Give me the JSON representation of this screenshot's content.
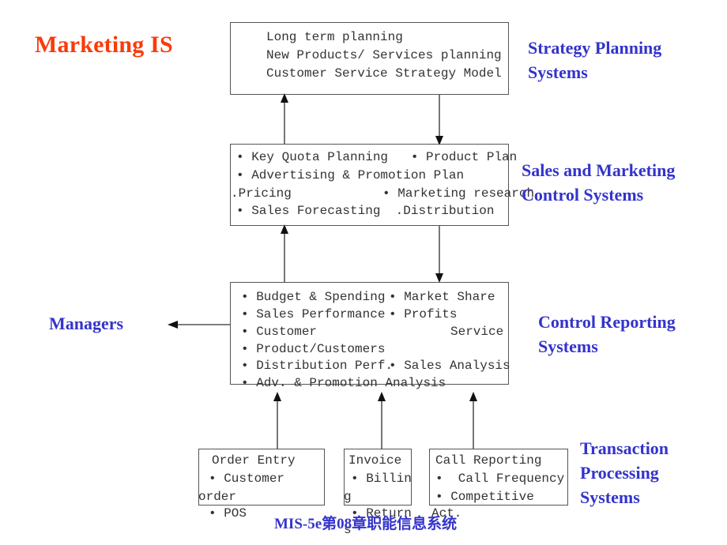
{
  "title": "Marketing IS",
  "footer": "MIS-5e第08章职能信息系统",
  "colors": {
    "title": "#fb3a09",
    "label": "#3333cc",
    "box_border": "#555555",
    "box_text": "#333333"
  },
  "side_labels": {
    "strategy": "Strategy Planning\nSystems",
    "strategy_line1": "Strategy Planning",
    "strategy_line2": "Systems",
    "sales_line1": "Sales and Marketing",
    "sales_line2": "Control Systems",
    "control_line1": "Control Reporting",
    "control_line2": "Systems",
    "transaction_line1": "Transaction",
    "transaction_line2": "Processing",
    "transaction_line3": "Systems",
    "managers": "Managers"
  },
  "boxes": {
    "strategy_planning": {
      "name": "Strategy Planning box",
      "lines": [
        "Long term planning",
        "New Products/ Services planning",
        "Customer Service Strategy Model"
      ]
    },
    "sales_marketing_control": {
      "name": "Sales and Marketing Control box",
      "lines": [
        "• Key Quota Planning   • Product Plan",
        "• Advertising & Promotion Plan",
        ".Pricing            • Marketing research",
        "• Sales Forecasting  .Distribution"
      ]
    },
    "control_reporting": {
      "name": "Control Reporting box",
      "left_lines": [
        "• Budget & Spending",
        "• Sales Performance",
        "• Customer",
        "• Product/Customers",
        "• Distribution Perf.",
        "• Adv. & Promotion Analysis"
      ],
      "right_lines": [
        "• Market Share",
        "• Profits",
        "Service",
        "",
        "• Sales Analysis"
      ]
    },
    "order_entry": {
      "name": "Order Entry box",
      "lines": [
        "Order Entry",
        "• Customer",
        "order",
        "• POS"
      ]
    },
    "invoice": {
      "name": "Invoice box",
      "lines": [
        "Invoice",
        "• Billin",
        "g",
        "• Return",
        "s"
      ]
    },
    "call_reporting": {
      "name": "Call Reporting box",
      "lines": [
        "Call Reporting",
        "•  Call Frequency",
        "• Competitive",
        "Act."
      ]
    }
  },
  "arrows": [
    {
      "id": "strategy-up",
      "direction": "up",
      "from": "sales-marketing-control",
      "to": "strategy-planning"
    },
    {
      "id": "strategy-down",
      "direction": "down",
      "from": "strategy-planning",
      "to": "sales-marketing-control"
    },
    {
      "id": "control-up",
      "direction": "up",
      "from": "control-reporting",
      "to": "sales-marketing-control"
    },
    {
      "id": "control-down",
      "direction": "down",
      "from": "sales-marketing-control",
      "to": "control-reporting"
    },
    {
      "id": "managers-left",
      "direction": "left",
      "from": "control-reporting",
      "to": "managers"
    },
    {
      "id": "order-entry-up",
      "direction": "up",
      "from": "order-entry",
      "to": "control-reporting"
    },
    {
      "id": "invoice-up",
      "direction": "up",
      "from": "invoice",
      "to": "control-reporting"
    },
    {
      "id": "call-reporting-up",
      "direction": "up",
      "from": "call-reporting",
      "to": "control-reporting"
    }
  ]
}
